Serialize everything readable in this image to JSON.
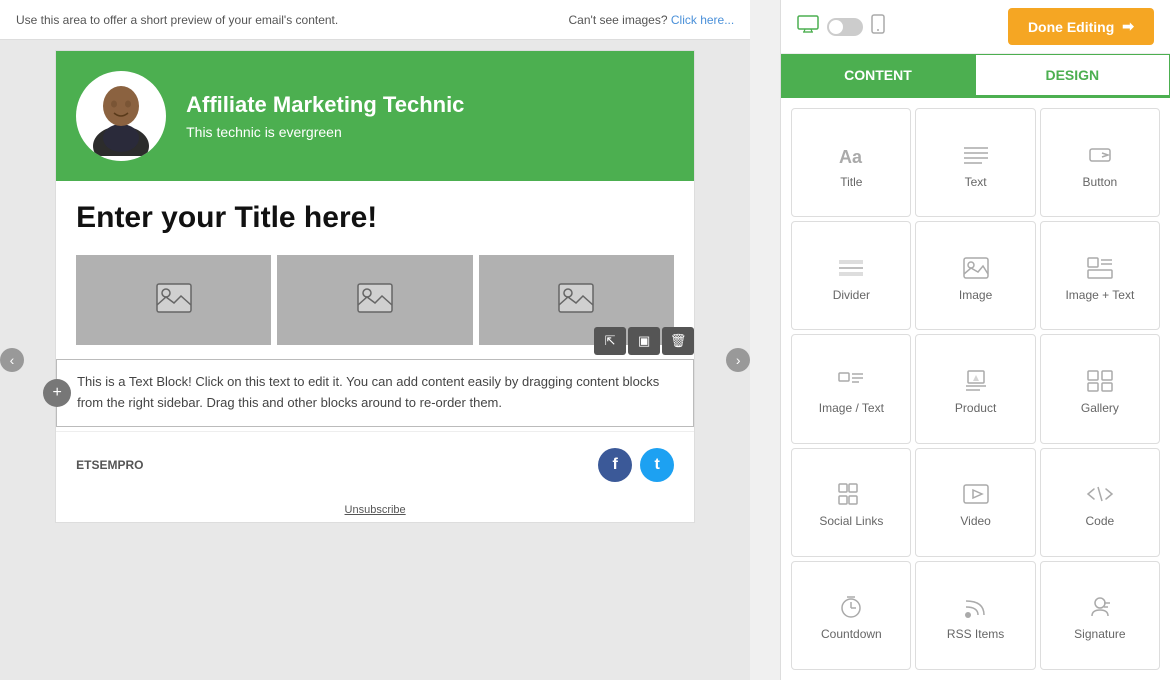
{
  "preview_bar": {
    "left_text": "Use this area to offer a short preview of your email's content.",
    "right_text": "Can't see images?",
    "right_link": "Click here..."
  },
  "header": {
    "brand_name": "Affiliate Marketing Technic",
    "tagline": "This technic is evergreen"
  },
  "email_title": "Enter your Title here!",
  "text_block": {
    "content": "This is a Text Block! Click on this text to edit it. You can add content easily by dragging content blocks from the right sidebar. Drag this and other blocks around to re-order them."
  },
  "footer": {
    "brand": "ETSEMPRO",
    "unsubscribe": "Unsubscribe"
  },
  "done_editing": {
    "label": "Done Editing",
    "icon": "→"
  },
  "tabs": {
    "content": "CONTENT",
    "design": "DESIGN"
  },
  "content_items": [
    {
      "id": "title",
      "label": "Title",
      "icon": "Aa"
    },
    {
      "id": "text",
      "label": "Text",
      "icon": "≡"
    },
    {
      "id": "button",
      "label": "Button",
      "icon": "↗"
    },
    {
      "id": "divider",
      "label": "Divider",
      "icon": "—"
    },
    {
      "id": "image",
      "label": "Image",
      "icon": "🖼"
    },
    {
      "id": "image-text",
      "label": "Image + Text",
      "icon": "⊞"
    },
    {
      "id": "image-text2",
      "label": "Image / Text",
      "icon": "⊡"
    },
    {
      "id": "product",
      "label": "Product",
      "icon": "✦"
    },
    {
      "id": "gallery",
      "label": "Gallery",
      "icon": "▦"
    },
    {
      "id": "social-links",
      "label": "Social Links",
      "icon": "⊕"
    },
    {
      "id": "video",
      "label": "Video",
      "icon": "▶"
    },
    {
      "id": "code",
      "label": "Code",
      "icon": "</>"
    },
    {
      "id": "countdown",
      "label": "Countdown",
      "icon": "⏱"
    },
    {
      "id": "rss-items",
      "label": "RSS Items",
      "icon": "◌"
    },
    {
      "id": "signature",
      "label": "Signature",
      "icon": "👤"
    }
  ],
  "colors": {
    "green": "#4caf50",
    "orange": "#f5a623",
    "facebook_blue": "#3b5998",
    "twitter_blue": "#1da1f2"
  }
}
